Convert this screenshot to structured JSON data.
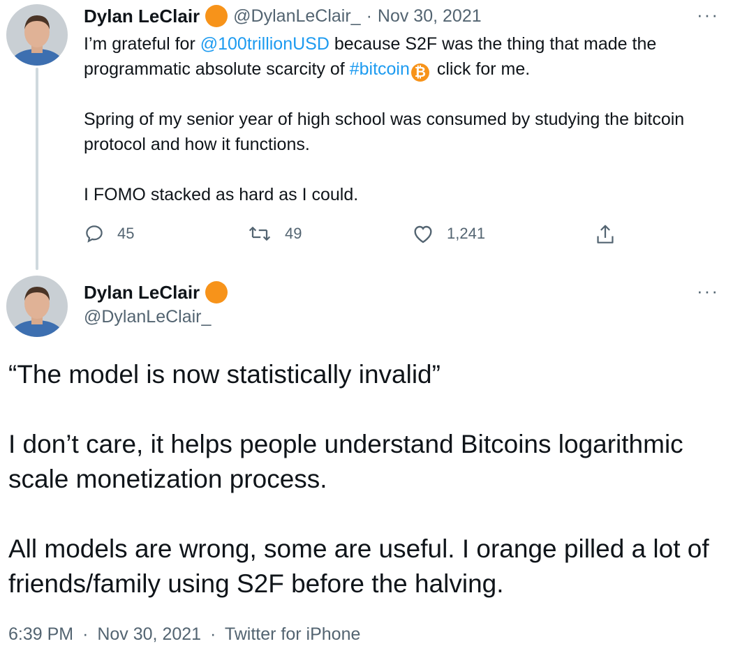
{
  "tweet1": {
    "display_name": "Dylan LeClair",
    "handle": "@DylanLeClair_",
    "separator": "·",
    "date": "Nov 30, 2021",
    "more": "···",
    "text_pre": "I’m grateful for ",
    "mention": "@100trillionUSD",
    "text_mid": " because S2F was the thing that made the programmatic absolute scarcity of ",
    "hashtag": "#bitcoin",
    "btc_symbol": "₿",
    "text_post": "click for me.",
    "para2": "Spring of my senior year of high school  was consumed by studying the bitcoin protocol and how it functions.",
    "para3": "I FOMO stacked as hard as I could.",
    "replies": "45",
    "retweets": "49",
    "likes": "1,241"
  },
  "tweet2": {
    "display_name": "Dylan LeClair",
    "handle": "@DylanLeClair_",
    "more": "···",
    "para1": "“The model is now statistically invalid”",
    "para2": "I don’t care, it helps people understand Bitcoins logarithmic scale monetization process.",
    "para3": "All models are wrong, some are useful. I orange pilled a lot of friends/family using S2F before the halving.",
    "time": "6:39 PM",
    "separator": "·",
    "date": "Nov 30, 2021",
    "source": "Twitter for iPhone"
  },
  "colors": {
    "accent": "#1d9bf0",
    "badge": "#f7931a",
    "muted": "#536471"
  }
}
